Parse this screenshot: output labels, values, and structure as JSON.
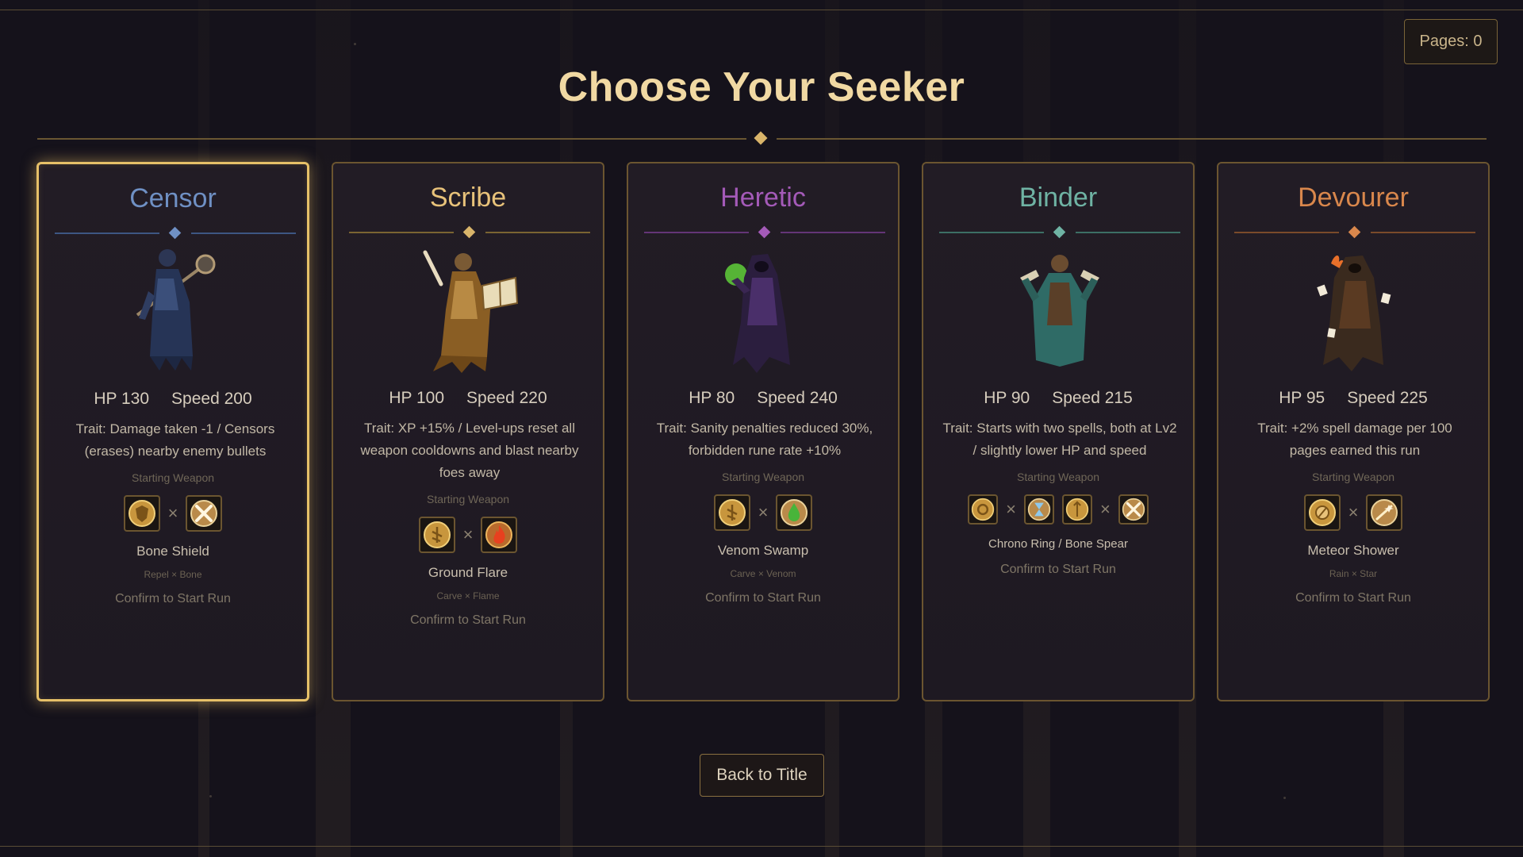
{
  "header": {
    "title": "Choose Your Seeker",
    "pages_label": "Pages: 0"
  },
  "colors": {
    "accent_gold": "#e6c068",
    "censor": "#6f90c4",
    "scribe": "#e8c27a",
    "heretic": "#a45ab8",
    "binder": "#6fb3a4",
    "devourer": "#d9874c"
  },
  "seekers": [
    {
      "name": "Censor",
      "selected": true,
      "hp": "HP 130",
      "speed": "Speed 200",
      "trait": "Trait: Damage taken -1 / Censors (erases) nearby enemy bullets",
      "starting_weapon_label": "Starting Weapon",
      "weapon_icons": [
        "shield-rune-icon",
        "crossed-bones-icon"
      ],
      "weapon_name": "Bone Shield",
      "weapon_combo": "Repel × Bone",
      "confirm": "Confirm to Start Run"
    },
    {
      "name": "Scribe",
      "selected": false,
      "hp": "HP 100",
      "speed": "Speed 220",
      "trait": "Trait: XP +15% / Level-ups reset all weapon cooldowns and blast nearby foes away",
      "starting_weapon_label": "Starting Weapon",
      "weapon_icons": [
        "carve-rune-icon",
        "flame-icon"
      ],
      "weapon_name": "Ground Flare",
      "weapon_combo": "Carve × Flame",
      "confirm": "Confirm to Start Run"
    },
    {
      "name": "Heretic",
      "selected": false,
      "hp": "HP 80",
      "speed": "Speed 240",
      "trait": "Trait: Sanity penalties reduced 30%, forbidden rune rate +10%",
      "starting_weapon_label": "Starting Weapon",
      "weapon_icons": [
        "carve-rune-icon",
        "venom-drop-icon"
      ],
      "weapon_name": "Venom Swamp",
      "weapon_combo": "Carve × Venom",
      "confirm": "Confirm to Start Run"
    },
    {
      "name": "Binder",
      "selected": false,
      "hp": "HP 90",
      "speed": "Speed 215",
      "trait": "Trait: Starts with two spells, both at Lv2 / slightly lower HP and speed",
      "starting_weapon_label": "Starting Weapon",
      "weapon_icons": [
        "ring-rune-icon",
        "hourglass-icon",
        "spear-rune-icon",
        "crossed-bones-icon"
      ],
      "weapon_name": "Chrono Ring / Bone Spear",
      "weapon_combo": "",
      "confirm": "Confirm to Start Run"
    },
    {
      "name": "Devourer",
      "selected": false,
      "hp": "HP 95",
      "speed": "Speed 225",
      "trait": "Trait: +2% spell damage per 100 pages earned this run",
      "starting_weapon_label": "Starting Weapon",
      "weapon_icons": [
        "rain-rune-icon",
        "star-icon"
      ],
      "weapon_name": "Meteor Shower",
      "weapon_combo": "Rain × Star",
      "confirm": "Confirm to Start Run"
    }
  ],
  "footer": {
    "back_label": "Back to Title"
  }
}
